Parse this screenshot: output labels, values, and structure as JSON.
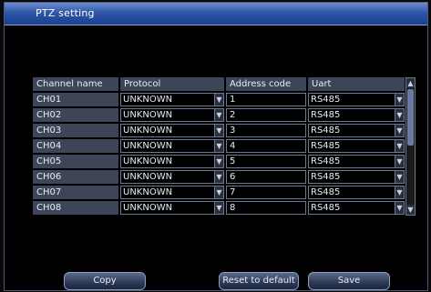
{
  "window": {
    "title": "PTZ setting"
  },
  "table": {
    "headers": {
      "name": "Channel name",
      "protocol": "Protocol",
      "address": "Address code",
      "uart": "Uart"
    },
    "rows": [
      {
        "name": "CH01",
        "protocol": "UNKNOWN",
        "address": "1",
        "uart": "RS485"
      },
      {
        "name": "CH02",
        "protocol": "UNKNOWN",
        "address": "2",
        "uart": "RS485"
      },
      {
        "name": "CH03",
        "protocol": "UNKNOWN",
        "address": "3",
        "uart": "RS485"
      },
      {
        "name": "CH04",
        "protocol": "UNKNOWN",
        "address": "4",
        "uart": "RS485"
      },
      {
        "name": "CH05",
        "protocol": "UNKNOWN",
        "address": "5",
        "uart": "RS485"
      },
      {
        "name": "CH06",
        "protocol": "UNKNOWN",
        "address": "6",
        "uart": "RS485"
      },
      {
        "name": "CH07",
        "protocol": "UNKNOWN",
        "address": "7",
        "uart": "RS485"
      },
      {
        "name": "CH08",
        "protocol": "UNKNOWN",
        "address": "8",
        "uart": "RS485"
      }
    ]
  },
  "buttons": {
    "copy": "Copy",
    "reset": "Reset to default",
    "save": "Save"
  }
}
